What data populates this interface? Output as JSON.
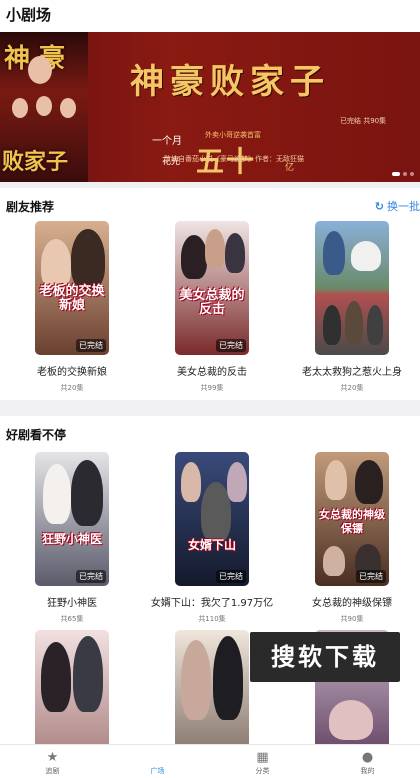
{
  "header": {
    "title": "小剧场"
  },
  "banner": {
    "poster_text_top": "神 豪",
    "poster_text_bottom": "败家子",
    "title": "神豪败家子",
    "status": "已完结 共90集",
    "month": "一个月",
    "subtitle": "外卖小哥逆袭首富",
    "flower": "花光",
    "amount": "五十",
    "unit": "亿",
    "credit": "改编自番茄小说《豪马追梦》作者：无敌狂猫"
  },
  "section1": {
    "title": "剧友推荐",
    "more_label": "换一批",
    "more_icon": "refresh-icon",
    "cards": [
      {
        "name": "老板的交换新娘",
        "count": "共20集",
        "badge": "已完结",
        "cover_text": "老板的交换新娘",
        "color_top": "#c8a080",
        "color_bottom": "#7a5040"
      },
      {
        "name": "美女总裁的反击",
        "count": "共99集",
        "badge": "已完结",
        "cover_text": "美女总裁的反击",
        "color_top": "#e8d8d8",
        "color_bottom": "#8a3a3a"
      },
      {
        "name": "老太太救狗之惹火上身",
        "count": "共20集",
        "badge": "",
        "cover_text": "",
        "color_top": "#7aa0c8",
        "color_bottom": "#5a6a5a"
      }
    ]
  },
  "section2": {
    "title": "好剧看不停",
    "cards": [
      {
        "name": "狂野小神医",
        "count": "共65集",
        "badge": "已完结",
        "cover_text": "狂野小神医",
        "color_top": "#d8d8dc",
        "color_bottom": "#6a6a7a"
      },
      {
        "name": "女婿下山：我欠了1.97万亿",
        "count": "共110集",
        "badge": "已完结",
        "cover_text": "女婿下山",
        "color_top": "#3a4a7a",
        "color_bottom": "#1a2238"
      },
      {
        "name": "女总裁的神级保镖",
        "count": "共90集",
        "badge": "已完结",
        "cover_text": "女总裁的神级保镖",
        "color_top": "#b08a6a",
        "color_bottom": "#5a3a2a"
      }
    ],
    "partial_cards": [
      {
        "cover_text": "",
        "color_top": "#f2e0e0",
        "color_bottom": "#b89090"
      },
      {
        "cover_text": "",
        "color_top": "#efe6dc",
        "color_bottom": "#8a7a70"
      },
      {
        "cover_text": "",
        "color_top": "#c8b8c8",
        "color_bottom": "#7a5a7a"
      }
    ]
  },
  "watermark": "搜软下载",
  "tabbar": {
    "tabs": [
      {
        "label": "追剧",
        "icon": "star-icon",
        "active": false
      },
      {
        "label": "广场",
        "icon": "play-icon",
        "active": true
      },
      {
        "label": "分类",
        "icon": "grid-icon",
        "active": false
      },
      {
        "label": "我的",
        "icon": "person-icon",
        "active": false
      }
    ]
  },
  "colors": {
    "accent": "#2f86e6",
    "banner_bg": "#7a1410",
    "banner_text": "#f3c766"
  }
}
